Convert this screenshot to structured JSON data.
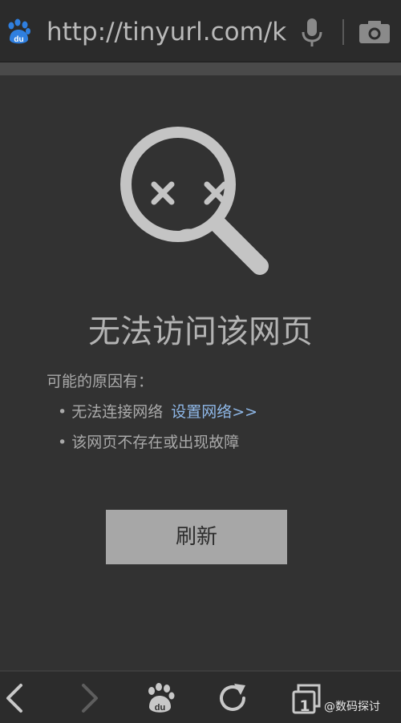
{
  "address_bar": {
    "url": "http://tinyurl.com/k"
  },
  "error": {
    "title": "无法访问该网页",
    "reasons_heading": "可能的原因有：",
    "reasons": [
      {
        "bullet": "•",
        "text": "无法连接网络",
        "link": "设置网络>>"
      },
      {
        "bullet": "•",
        "text": "该网页不存在或出现故障"
      }
    ]
  },
  "refresh_button": {
    "label": "刷新"
  },
  "tabs": {
    "count": "1"
  },
  "watermark": {
    "text": "@数码探讨"
  },
  "colors": {
    "background": "#323232",
    "link": "#8fb8e8",
    "button": "#a7a7a7",
    "icon": "#c4c4c4",
    "baidu_blue": "#2f7fe0"
  },
  "icons": [
    "baidu-paw-icon",
    "microphone-icon",
    "camera-icon",
    "sad-magnifier-icon",
    "back-arrow-icon",
    "forward-arrow-icon",
    "home-paw-icon",
    "refresh-icon",
    "tabs-icon"
  ]
}
